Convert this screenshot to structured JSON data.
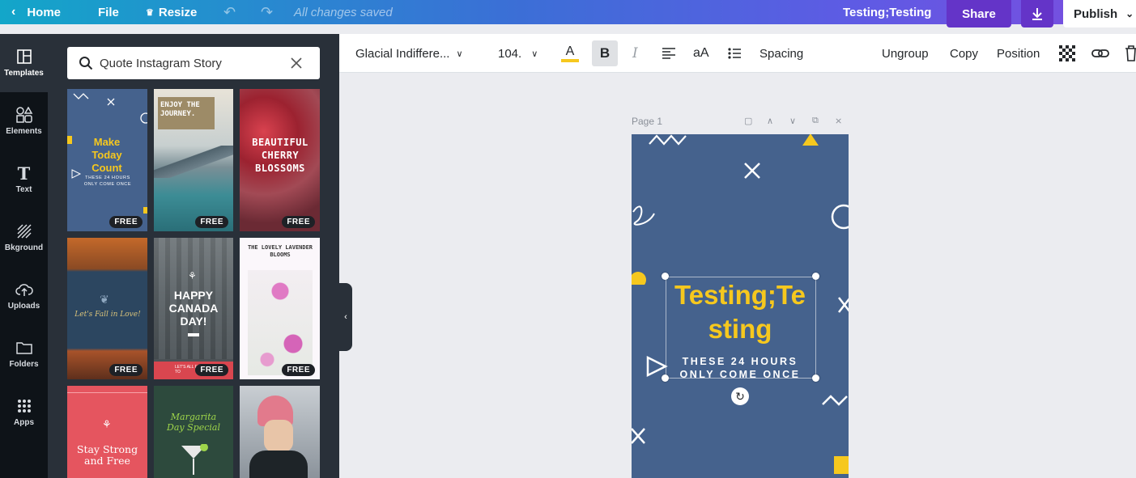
{
  "topbar": {
    "home_label": "Home",
    "file_label": "File",
    "resize_label": "Resize",
    "save_status": "All changes saved",
    "doc_title": "Testing;Testing",
    "share_label": "Share",
    "publish_label": "Publish"
  },
  "rail": {
    "items": [
      {
        "label": "Templates"
      },
      {
        "label": "Elements"
      },
      {
        "label": "Text"
      },
      {
        "label": "Bkground"
      },
      {
        "label": "Uploads"
      },
      {
        "label": "Folders"
      },
      {
        "label": "Apps"
      }
    ]
  },
  "panel": {
    "search_value": "Quote Instagram Story",
    "free_badge": "FREE",
    "templates": [
      {
        "text": "Make Today Count",
        "sub": "THESE 24 HOURS ONLY COME ONCE"
      },
      {
        "text": "ENJOY THE JOURNEY."
      },
      {
        "text": "BEAUTIFUL CHERRY BLOSSOMS"
      },
      {
        "text": "Let's Fall in Love!"
      },
      {
        "text": "HAPPY CANADA DAY!",
        "sub": "LET'S ALL FUN TO"
      },
      {
        "text": "THE LOVELY LAVENDER BLOOMS"
      },
      {
        "text": "Stay Strong and Free"
      },
      {
        "text": "Margarita Day Special"
      }
    ]
  },
  "toolbar": {
    "font_name": "Glacial Indiffere...",
    "font_size": "104.",
    "bold": "B",
    "italic": "I",
    "case": "aA",
    "spacing_label": "Spacing",
    "ungroup_label": "Ungroup",
    "copy_label": "Copy",
    "position_label": "Position",
    "text_color": "#f6c81e"
  },
  "page": {
    "label": "Page 1"
  },
  "design": {
    "headline": "Testing;Te sting",
    "subline": "THESE 24 HOURS ONLY COME ONCE",
    "background": "#45628d",
    "accent": "#f6c81e"
  }
}
